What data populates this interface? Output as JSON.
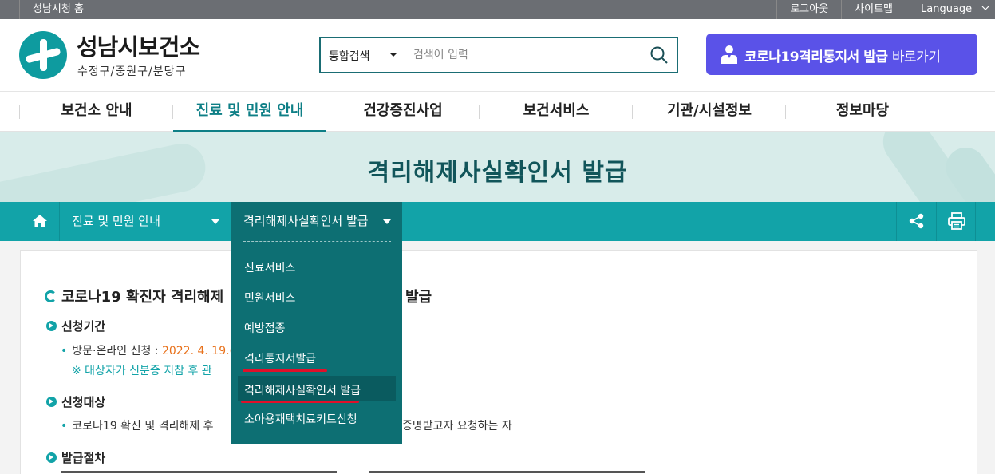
{
  "topbar": {
    "home": "성남시청 홈",
    "logout": "로그아웃",
    "sitemap": "사이트맵",
    "language": "Language"
  },
  "header": {
    "logo_title": "성남시보건소",
    "logo_sub": "수정구/중원구/분당구",
    "search_scope": "통합검색",
    "search_placeholder": "검색어 입력",
    "covid_button_bold": "코로나19격리통지서 발급",
    "covid_button_rest": "바로가기",
    "covid_button_color": "#5a52e8"
  },
  "gnb": {
    "items": [
      "보건소 안내",
      "진료 및 민원 안내",
      "건강증진사업",
      "보건서비스",
      "기관/시설정보",
      "정보마당"
    ],
    "active": "진료 및 민원 안내"
  },
  "banner": {
    "title": "격리해제사실확인서 발급"
  },
  "location": {
    "depth1": "진료 및 민원 안내",
    "depth2": "격리해제사실확인서 발급",
    "accent": "#12a3a8"
  },
  "dropdown": {
    "options": [
      "진료서비스",
      "민원서비스",
      "예방접종",
      "격리통지서발급",
      "격리해제사실확인서 발급",
      "소아용재택치료키트신청"
    ],
    "selected": "격리해제사실확인서 발급"
  },
  "content": {
    "title_left": "코로나19 확진자 격리해제",
    "title_right": "발급",
    "sec1": "신청기간",
    "sec1_bullet_prefix": "방문·온라인 신청 : ",
    "sec1_bullet_date": "2022. 4. 19.(",
    "sec1_note": "※ 대상자가 신분증 지참 후 관",
    "sec2": "신청대상",
    "sec2_bullet_left": "코로나19 확진 및 격리해제 후",
    "sec2_bullet_right": "증명받고자 요청하는 자",
    "sec3": "발급절차"
  }
}
